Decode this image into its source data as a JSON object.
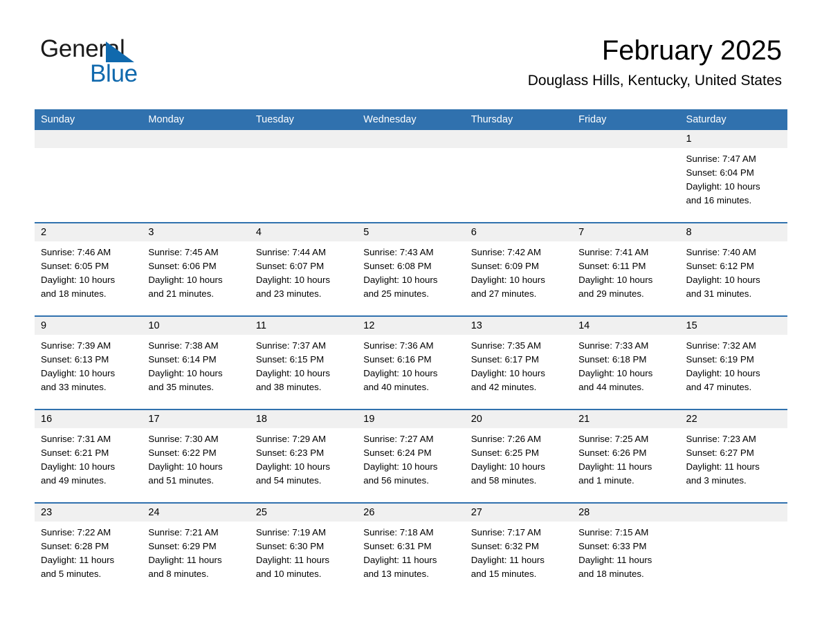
{
  "brand": {
    "name_part1": "General",
    "name_part2": "Blue",
    "triangle_color": "#1069ad"
  },
  "header": {
    "title": "February 2025",
    "location": "Douglass Hills, Kentucky, United States"
  },
  "theme": {
    "header_blue": "#3071ae",
    "row_gray": "#f0f0f0",
    "text_black": "#000000"
  },
  "weekday_headers": [
    "Sunday",
    "Monday",
    "Tuesday",
    "Wednesday",
    "Thursday",
    "Friday",
    "Saturday"
  ],
  "weeks": [
    [
      {
        "day": "",
        "sunrise": "",
        "sunset": "",
        "daylight1": "",
        "daylight2": ""
      },
      {
        "day": "",
        "sunrise": "",
        "sunset": "",
        "daylight1": "",
        "daylight2": ""
      },
      {
        "day": "",
        "sunrise": "",
        "sunset": "",
        "daylight1": "",
        "daylight2": ""
      },
      {
        "day": "",
        "sunrise": "",
        "sunset": "",
        "daylight1": "",
        "daylight2": ""
      },
      {
        "day": "",
        "sunrise": "",
        "sunset": "",
        "daylight1": "",
        "daylight2": ""
      },
      {
        "day": "",
        "sunrise": "",
        "sunset": "",
        "daylight1": "",
        "daylight2": ""
      },
      {
        "day": "1",
        "sunrise": "Sunrise: 7:47 AM",
        "sunset": "Sunset: 6:04 PM",
        "daylight1": "Daylight: 10 hours",
        "daylight2": "and 16 minutes."
      }
    ],
    [
      {
        "day": "2",
        "sunrise": "Sunrise: 7:46 AM",
        "sunset": "Sunset: 6:05 PM",
        "daylight1": "Daylight: 10 hours",
        "daylight2": "and 18 minutes."
      },
      {
        "day": "3",
        "sunrise": "Sunrise: 7:45 AM",
        "sunset": "Sunset: 6:06 PM",
        "daylight1": "Daylight: 10 hours",
        "daylight2": "and 21 minutes."
      },
      {
        "day": "4",
        "sunrise": "Sunrise: 7:44 AM",
        "sunset": "Sunset: 6:07 PM",
        "daylight1": "Daylight: 10 hours",
        "daylight2": "and 23 minutes."
      },
      {
        "day": "5",
        "sunrise": "Sunrise: 7:43 AM",
        "sunset": "Sunset: 6:08 PM",
        "daylight1": "Daylight: 10 hours",
        "daylight2": "and 25 minutes."
      },
      {
        "day": "6",
        "sunrise": "Sunrise: 7:42 AM",
        "sunset": "Sunset: 6:09 PM",
        "daylight1": "Daylight: 10 hours",
        "daylight2": "and 27 minutes."
      },
      {
        "day": "7",
        "sunrise": "Sunrise: 7:41 AM",
        "sunset": "Sunset: 6:11 PM",
        "daylight1": "Daylight: 10 hours",
        "daylight2": "and 29 minutes."
      },
      {
        "day": "8",
        "sunrise": "Sunrise: 7:40 AM",
        "sunset": "Sunset: 6:12 PM",
        "daylight1": "Daylight: 10 hours",
        "daylight2": "and 31 minutes."
      }
    ],
    [
      {
        "day": "9",
        "sunrise": "Sunrise: 7:39 AM",
        "sunset": "Sunset: 6:13 PM",
        "daylight1": "Daylight: 10 hours",
        "daylight2": "and 33 minutes."
      },
      {
        "day": "10",
        "sunrise": "Sunrise: 7:38 AM",
        "sunset": "Sunset: 6:14 PM",
        "daylight1": "Daylight: 10 hours",
        "daylight2": "and 35 minutes."
      },
      {
        "day": "11",
        "sunrise": "Sunrise: 7:37 AM",
        "sunset": "Sunset: 6:15 PM",
        "daylight1": "Daylight: 10 hours",
        "daylight2": "and 38 minutes."
      },
      {
        "day": "12",
        "sunrise": "Sunrise: 7:36 AM",
        "sunset": "Sunset: 6:16 PM",
        "daylight1": "Daylight: 10 hours",
        "daylight2": "and 40 minutes."
      },
      {
        "day": "13",
        "sunrise": "Sunrise: 7:35 AM",
        "sunset": "Sunset: 6:17 PM",
        "daylight1": "Daylight: 10 hours",
        "daylight2": "and 42 minutes."
      },
      {
        "day": "14",
        "sunrise": "Sunrise: 7:33 AM",
        "sunset": "Sunset: 6:18 PM",
        "daylight1": "Daylight: 10 hours",
        "daylight2": "and 44 minutes."
      },
      {
        "day": "15",
        "sunrise": "Sunrise: 7:32 AM",
        "sunset": "Sunset: 6:19 PM",
        "daylight1": "Daylight: 10 hours",
        "daylight2": "and 47 minutes."
      }
    ],
    [
      {
        "day": "16",
        "sunrise": "Sunrise: 7:31 AM",
        "sunset": "Sunset: 6:21 PM",
        "daylight1": "Daylight: 10 hours",
        "daylight2": "and 49 minutes."
      },
      {
        "day": "17",
        "sunrise": "Sunrise: 7:30 AM",
        "sunset": "Sunset: 6:22 PM",
        "daylight1": "Daylight: 10 hours",
        "daylight2": "and 51 minutes."
      },
      {
        "day": "18",
        "sunrise": "Sunrise: 7:29 AM",
        "sunset": "Sunset: 6:23 PM",
        "daylight1": "Daylight: 10 hours",
        "daylight2": "and 54 minutes."
      },
      {
        "day": "19",
        "sunrise": "Sunrise: 7:27 AM",
        "sunset": "Sunset: 6:24 PM",
        "daylight1": "Daylight: 10 hours",
        "daylight2": "and 56 minutes."
      },
      {
        "day": "20",
        "sunrise": "Sunrise: 7:26 AM",
        "sunset": "Sunset: 6:25 PM",
        "daylight1": "Daylight: 10 hours",
        "daylight2": "and 58 minutes."
      },
      {
        "day": "21",
        "sunrise": "Sunrise: 7:25 AM",
        "sunset": "Sunset: 6:26 PM",
        "daylight1": "Daylight: 11 hours",
        "daylight2": "and 1 minute."
      },
      {
        "day": "22",
        "sunrise": "Sunrise: 7:23 AM",
        "sunset": "Sunset: 6:27 PM",
        "daylight1": "Daylight: 11 hours",
        "daylight2": "and 3 minutes."
      }
    ],
    [
      {
        "day": "23",
        "sunrise": "Sunrise: 7:22 AM",
        "sunset": "Sunset: 6:28 PM",
        "daylight1": "Daylight: 11 hours",
        "daylight2": "and 5 minutes."
      },
      {
        "day": "24",
        "sunrise": "Sunrise: 7:21 AM",
        "sunset": "Sunset: 6:29 PM",
        "daylight1": "Daylight: 11 hours",
        "daylight2": "and 8 minutes."
      },
      {
        "day": "25",
        "sunrise": "Sunrise: 7:19 AM",
        "sunset": "Sunset: 6:30 PM",
        "daylight1": "Daylight: 11 hours",
        "daylight2": "and 10 minutes."
      },
      {
        "day": "26",
        "sunrise": "Sunrise: 7:18 AM",
        "sunset": "Sunset: 6:31 PM",
        "daylight1": "Daylight: 11 hours",
        "daylight2": "and 13 minutes."
      },
      {
        "day": "27",
        "sunrise": "Sunrise: 7:17 AM",
        "sunset": "Sunset: 6:32 PM",
        "daylight1": "Daylight: 11 hours",
        "daylight2": "and 15 minutes."
      },
      {
        "day": "28",
        "sunrise": "Sunrise: 7:15 AM",
        "sunset": "Sunset: 6:33 PM",
        "daylight1": "Daylight: 11 hours",
        "daylight2": "and 18 minutes."
      },
      {
        "day": "",
        "sunrise": "",
        "sunset": "",
        "daylight1": "",
        "daylight2": ""
      }
    ]
  ]
}
